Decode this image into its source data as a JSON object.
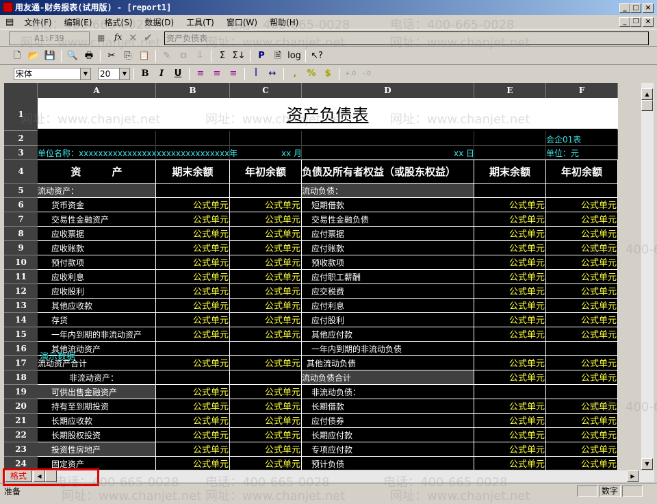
{
  "window": {
    "title": "用友通-财务报表(试用版) - [report1]"
  },
  "menu": [
    "文件(F)",
    "编辑(E)",
    "格式(S)",
    "数据(D)",
    "工具(T)",
    "窗口(W)",
    "帮助(H)"
  ],
  "formula_bar": {
    "cell_ref": "A1:F39",
    "content": "资产负债表"
  },
  "format_toolbar": {
    "font": "宋体",
    "size": "20"
  },
  "toolbar_icons": [
    "new-icon",
    "open-icon",
    "save-icon",
    "print-preview-icon",
    "print-icon",
    "cut-icon",
    "copy-icon",
    "paste-icon",
    "format-painter-icon",
    "insert-icon",
    "fill-icon",
    "sum-icon",
    "sum-col-icon",
    "p-icon",
    "page-icon",
    "log-icon",
    "help-icon"
  ],
  "columns": [
    "A",
    "B",
    "C",
    "D",
    "E",
    "F"
  ],
  "report": {
    "title": "资产负债表",
    "form_no": "会企01表",
    "unit_name": "单位名称：xxxxxxxxxxxxxxxxxxxxxxxxxxxxxxx年",
    "month": "xx 月",
    "day": "xx 日",
    "currency": "单位：元",
    "headers": [
      "资　　　产",
      "期末余额",
      "年初余额",
      "负债及所有者权益（或股东权益）",
      "期末余额",
      "年初余额"
    ],
    "formula_text": "公式单元",
    "demo_label": "演示数据",
    "rows": [
      {
        "n": "5",
        "a": "流动资产：",
        "ag": true,
        "ai": 0,
        "af": false,
        "d": "流动负债：",
        "dg": true,
        "di": 0,
        "df": false
      },
      {
        "n": "6",
        "a": "货币资金",
        "ai": 20,
        "af": true,
        "d": "短期借款",
        "di": 14,
        "df": true
      },
      {
        "n": "7",
        "a": "交易性金融资产",
        "ai": 20,
        "af": true,
        "d": "交易性金融负债",
        "di": 14,
        "df": true
      },
      {
        "n": "8",
        "a": "应收票据",
        "ai": 20,
        "af": true,
        "d": "应付票据",
        "di": 14,
        "df": true
      },
      {
        "n": "9",
        "a": "应收账款",
        "ai": 20,
        "af": true,
        "d": "应付账款",
        "di": 14,
        "df": true
      },
      {
        "n": "10",
        "a": "预付款项",
        "ai": 20,
        "af": true,
        "d": "预收款项",
        "di": 14,
        "df": true
      },
      {
        "n": "11",
        "a": "应收利息",
        "ai": 20,
        "af": true,
        "d": "应付职工薪酬",
        "di": 14,
        "df": true
      },
      {
        "n": "12",
        "a": "应收股利",
        "ai": 20,
        "af": true,
        "d": "应交税费",
        "di": 14,
        "df": true
      },
      {
        "n": "13",
        "a": "其他应收款",
        "ai": 20,
        "af": true,
        "d": "应付利息",
        "di": 14,
        "df": true
      },
      {
        "n": "14",
        "a": "存货",
        "ai": 20,
        "af": true,
        "d": "应付股利",
        "di": 14,
        "df": true
      },
      {
        "n": "15",
        "a": "一年内到期的非流动资产",
        "ai": 20,
        "af": true,
        "d": "其他应付款",
        "di": 14,
        "df": true
      },
      {
        "n": "16",
        "a": "其他流动资产",
        "ai": 20,
        "af": false,
        "d": "一年内到期的非流动负债",
        "di": 14,
        "df": false
      },
      {
        "n": "17",
        "a": "流动资产合计",
        "ai": 0,
        "af": true,
        "d": "其他流动负债",
        "di": 7,
        "df": true
      },
      {
        "n": "18",
        "a": "非流动资产：",
        "ai": 46,
        "af": false,
        "d": "流动负债合计",
        "dg": true,
        "di": 0,
        "df": true
      },
      {
        "n": "19",
        "a": "可供出售金融资产",
        "ag": true,
        "ai": 20,
        "af": true,
        "d": "非流动负债：",
        "di": 14,
        "df": false
      },
      {
        "n": "20",
        "a": "持有至到期投资",
        "ai": 20,
        "af": true,
        "d": "长期借款",
        "di": 14,
        "df": true
      },
      {
        "n": "21",
        "a": "长期应收款",
        "ai": 20,
        "af": true,
        "d": "应付债券",
        "di": 14,
        "df": true
      },
      {
        "n": "22",
        "a": "长期股权投资",
        "ai": 20,
        "af": true,
        "d": "长期应付款",
        "di": 14,
        "df": true
      },
      {
        "n": "23",
        "a": "投资性房地产",
        "ag": true,
        "ai": 20,
        "af": true,
        "d": "专项应付款",
        "di": 14,
        "df": true
      },
      {
        "n": "24",
        "a": "固定资产",
        "ai": 20,
        "af": true,
        "d": "预计负债",
        "di": 14,
        "df": true
      }
    ]
  },
  "sheet_tab": "格式",
  "status": {
    "text": "准备",
    "num": "数字"
  },
  "watermark": {
    "phone": "电话：400-665-0028",
    "site": "网址：www.chanjet.net"
  },
  "colors": {
    "formula": "#ffff40",
    "cyan": "#40e0e0",
    "header_bg": "#404040",
    "title_bar": "#0a246a",
    "highlight": "#e00000"
  }
}
